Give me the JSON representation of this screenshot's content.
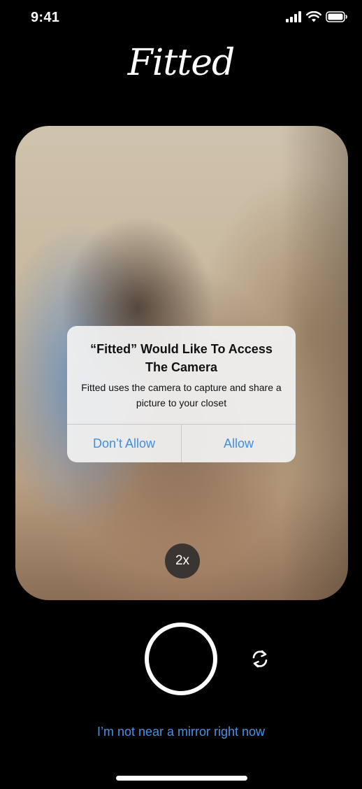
{
  "status_bar": {
    "time": "9:41",
    "icons": [
      "signal-icon",
      "wifi-icon",
      "battery-icon"
    ]
  },
  "app": {
    "logo_text": "Fitted"
  },
  "camera": {
    "zoom_label": "2x",
    "flip_icon": "flip-camera-icon",
    "shutter_icon": "shutter-ring"
  },
  "alert": {
    "title": "“Fitted” Would Like To Access The Camera",
    "message": "Fitted uses the camera to capture and share a picture to your closet",
    "deny_label": "Don’t Allow",
    "allow_label": "Allow"
  },
  "footer": {
    "mirror_link": "I’m not near a mirror right now"
  },
  "colors": {
    "background": "#000000",
    "link_blue": "#4a90e2",
    "alert_button_blue": "#3d8fe0",
    "alert_background": "#f2f2f2"
  }
}
